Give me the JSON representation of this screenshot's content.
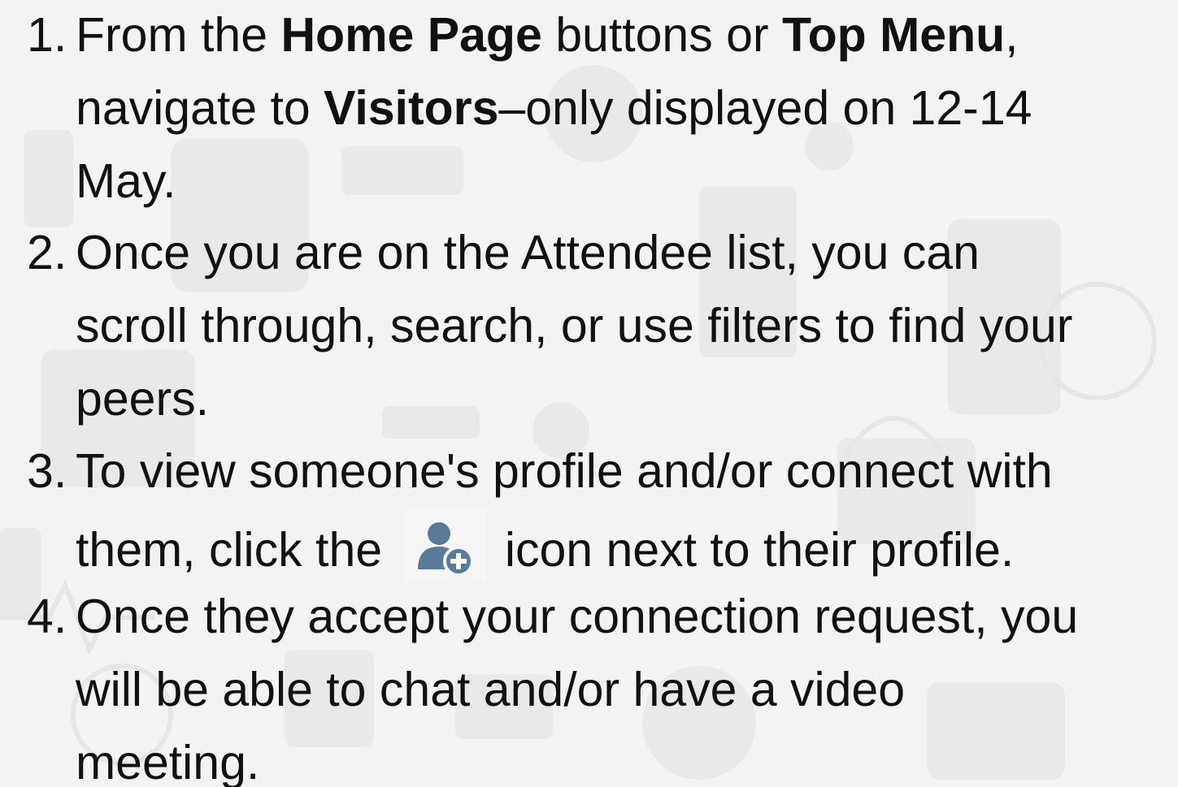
{
  "steps": [
    {
      "number": "1.",
      "text_a": "From the ",
      "bold_a": "Home Page",
      "text_b": " buttons or ",
      "bold_b": "Top Menu",
      "text_c": ",",
      "text_d": "navigate to ",
      "bold_c": "Visitors",
      "text_e": "–only displayed on 12-14",
      "text_f": "May."
    },
    {
      "number": "2.",
      "line_1": "Once you are on the Attendee list, you can",
      "line_2": "scroll through, search, or use filters to find your",
      "line_3": "peers."
    },
    {
      "number": "3.",
      "line_1": "To view someone's profile and/or connect with",
      "line_2_before": "them, click the ",
      "line_2_after": " icon next to their profile.",
      "icon": "add-user-icon"
    },
    {
      "number": "4.",
      "line_1": "Once they accept your connection request, you",
      "line_2": "will be able to chat and/or have a video",
      "line_3": "meeting."
    }
  ],
  "colors": {
    "text": "#111111",
    "background": "#f3f3f3",
    "icon": "#5a7a99"
  }
}
